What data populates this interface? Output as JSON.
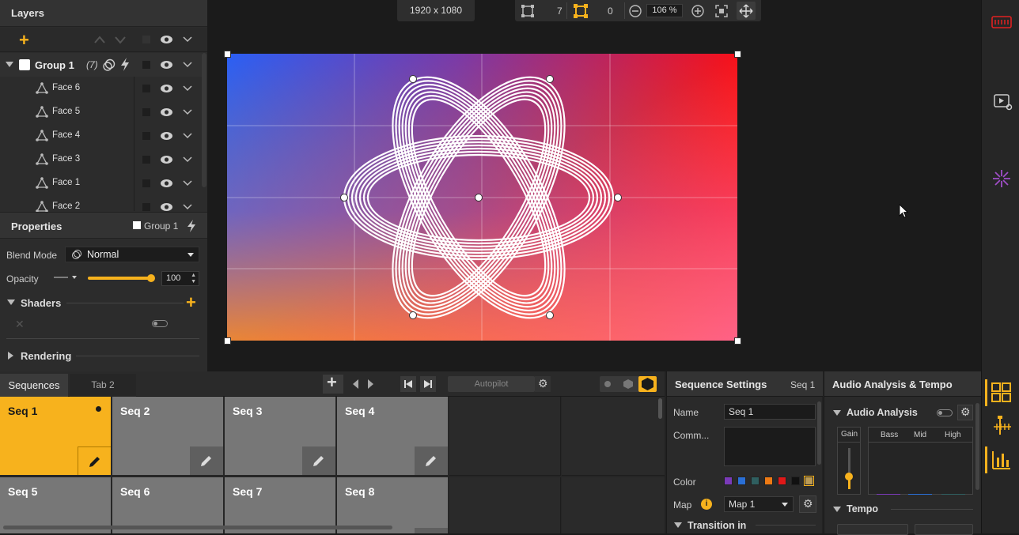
{
  "layers": {
    "title": "Layers",
    "group": {
      "name": "Group 1",
      "count": "(7)"
    },
    "faces": [
      "Face 6",
      "Face 5",
      "Face 4",
      "Face 3",
      "Face 1",
      "Face 2"
    ]
  },
  "properties": {
    "title": "Properties",
    "target": "Group 1",
    "blend_mode_label": "Blend Mode",
    "blend_mode_value": "Normal",
    "opacity_label": "Opacity",
    "opacity_value": "100",
    "opacity_level": 1.0,
    "shaders_label": "Shaders",
    "rendering_label": "Rendering"
  },
  "toolbar": {
    "resolution": "1920 x 1080",
    "count_a": "7",
    "count_b": "0",
    "zoom": "106 %"
  },
  "sequences": {
    "tabs": [
      "Sequences",
      "Tab 2"
    ],
    "autopilot_label": "Autopilot",
    "items": [
      "Seq 1",
      "Seq 2",
      "Seq 3",
      "Seq 4",
      "Seq 5",
      "Seq 6",
      "Seq 7",
      "Seq 8"
    ]
  },
  "seq_settings": {
    "title": "Sequence Settings",
    "current": "Seq 1",
    "name_label": "Name",
    "name_value": "Seq 1",
    "comment_label": "Comm...",
    "color_label": "Color",
    "map_label": "Map",
    "map_value": "Map 1",
    "transition_label": "Transition in",
    "colors": [
      "#7a3ab8",
      "#2a6fd6",
      "#2f5f60",
      "#ee7a14",
      "#e01818",
      "#111111",
      "#b99a55"
    ]
  },
  "audio": {
    "title": "Audio Analysis & Tempo",
    "section": "Audio Analysis",
    "gain_label": "Gain",
    "bands": [
      "Bass",
      "Mid",
      "High"
    ],
    "tempo_label": "Tempo"
  },
  "colors": {
    "accent": "#f7b21d"
  }
}
